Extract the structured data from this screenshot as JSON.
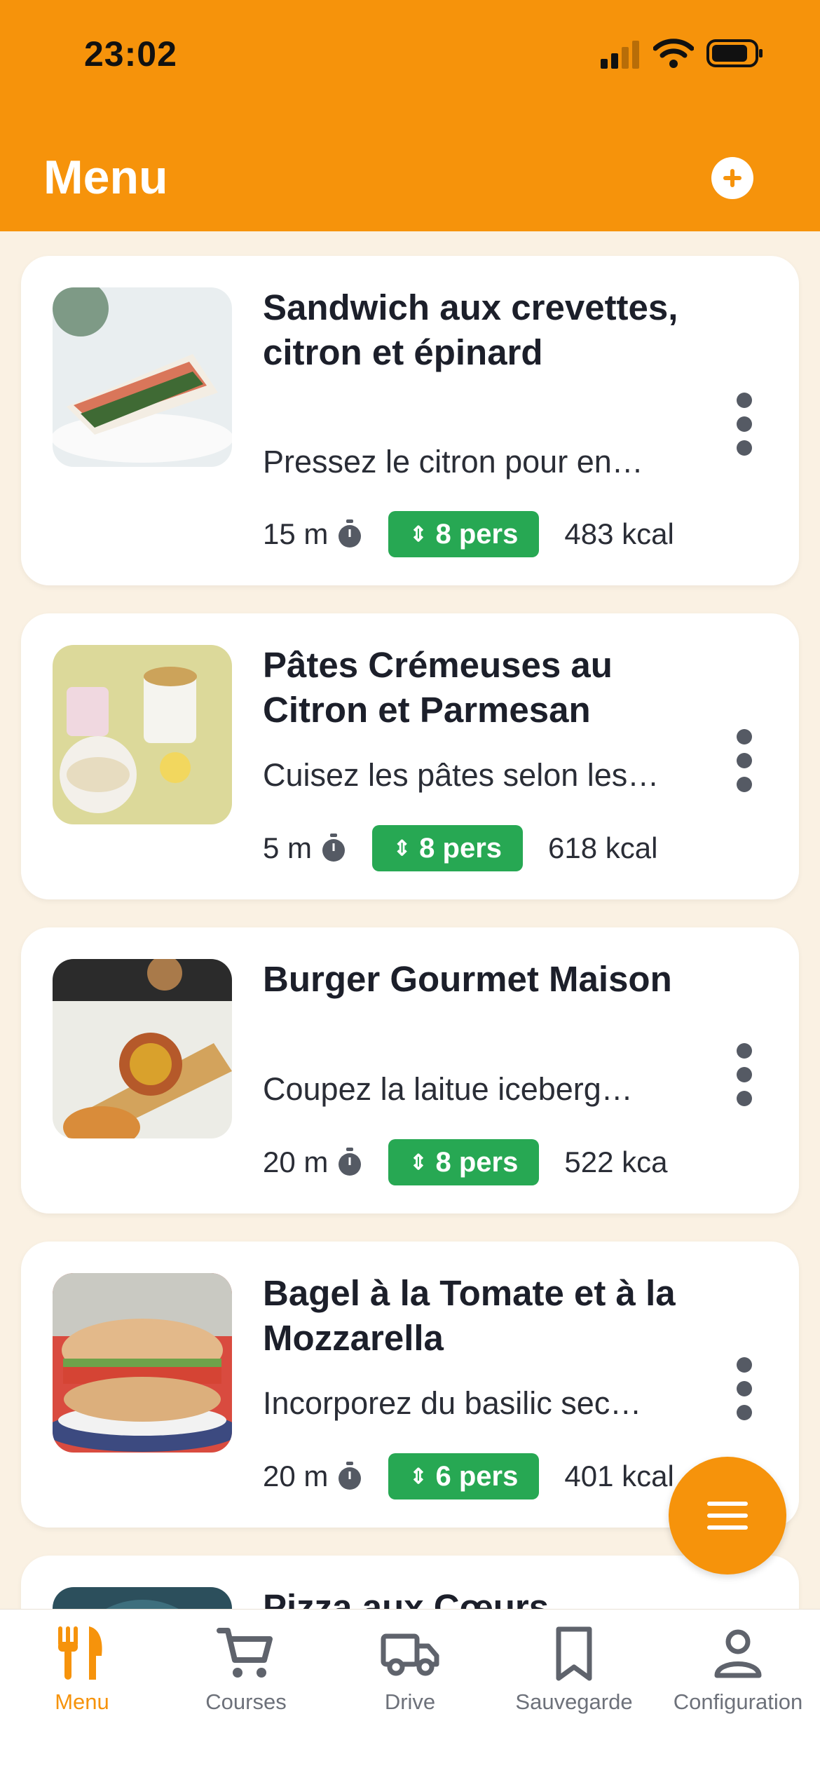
{
  "status_bar": {
    "time": "23:02"
  },
  "header": {
    "title": "Menu"
  },
  "recipes": [
    {
      "name": "Sandwich aux crevettes, citron et épinard",
      "description": "Pressez le citron pour en…",
      "time": "15 m",
      "servings": "8 pers",
      "calories": "483 kcal"
    },
    {
      "name": "Pâtes Crémeuses au Citron et Parmesan",
      "description": "Cuisez les pâtes selon les…",
      "time": "5 m",
      "servings": "8 pers",
      "calories": "618 kcal"
    },
    {
      "name": "Burger Gourmet Maison",
      "description": "Coupez la laitue iceberg…",
      "time": "20 m",
      "servings": "8 pers",
      "calories": "522 kca"
    },
    {
      "name": "Bagel à la Tomate et à la Mozzarella",
      "description": "Incorporez du basilic sec…",
      "time": "20 m",
      "servings": "6 pers",
      "calories": "401 kcal"
    },
    {
      "name": "Pizza aux Cœurs",
      "description": "",
      "time": "",
      "servings": "",
      "calories": ""
    }
  ],
  "tabs": [
    {
      "label": "Menu",
      "icon": "fork-knife-icon",
      "active": true
    },
    {
      "label": "Courses",
      "icon": "cart-icon",
      "active": false
    },
    {
      "label": "Drive",
      "icon": "truck-icon",
      "active": false
    },
    {
      "label": "Sauvegarde",
      "icon": "bookmark-icon",
      "active": false
    },
    {
      "label": "Configuration",
      "icon": "user-icon",
      "active": false
    }
  ],
  "colors": {
    "accent": "#f6930b",
    "servings_badge": "#27a853",
    "background": "#faf1e3"
  }
}
